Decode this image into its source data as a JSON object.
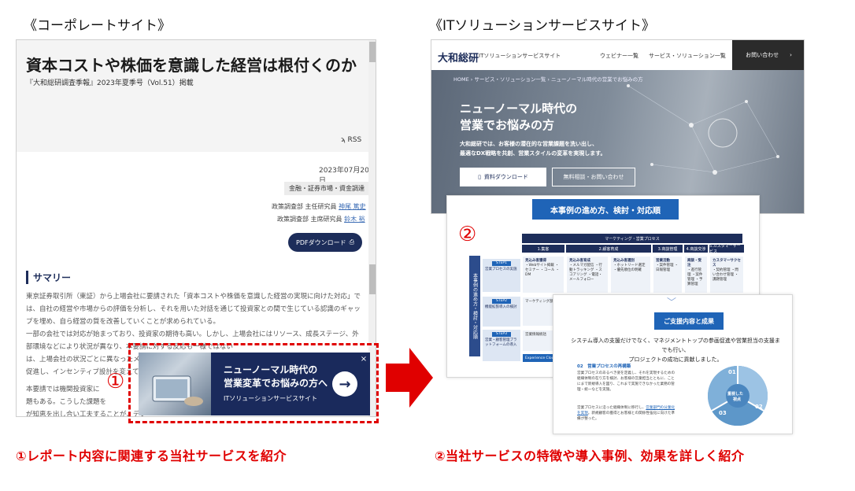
{
  "headings": {
    "left": "《コーポレートサイト》",
    "right": "《ITソリューションサービスサイト》"
  },
  "corporate": {
    "title": "資本コストや株価を意識した経営は根付くのか",
    "subtitle": "『大和総研調査季報』2023年夏季号（Vol.51）掲載",
    "rss": "RSS",
    "date": "2023年07月20日",
    "tag": "金融・証券市場・資金調達",
    "authors": [
      {
        "role": "政策調査部 主任研究員",
        "name": "神尾 篤史"
      },
      {
        "role": "政策調査部 主席研究員",
        "name": "鈴木 裕"
      }
    ],
    "pdf_button": "PDFダウンロード",
    "summary_heading": "サマリー",
    "paragraph1": "東京証券取引所（東証）から上場会社に要請された「資本コストや株価を意識した経営の実現に向けた対応」では、自社の経営や市場からの評価を分析し、それを用いた対話を通じて投資家との間で生じている認識のギャップを埋め、自ら経営の質を改善していくことが求められている。",
    "paragraph2": "一部の会社では対応が始まっており、投資家の期待も高い。しかし、上場会社にはリソース、成長ステージ、外部環境などにより状況が異なり、本要請に対する反応も一様ではない",
    "paragraph2b": "は、上場会社の状況ごとに異なったメッ",
    "paragraph2c": "促進し、インセンティブ設計を変えていく",
    "paragraph3a": "本要請では機関投資家に",
    "paragraph3b": "題もある。こうした課題を",
    "paragraph3c": "が知恵を出し合い工夫することが、デフ"
  },
  "banner": {
    "line1": "ニューノーマル時代の",
    "line2": "営業変革でお悩みの方へ",
    "sub": "ITソリューションサービスサイト",
    "close": "×",
    "arrow": "→"
  },
  "markers": {
    "one": "①",
    "two": "②"
  },
  "itsite": {
    "logo": "大和総研",
    "logo_sub": "ITソリューションサービスサイト",
    "nav": [
      "ウェビナー一覧",
      "サービス・ソリューション一覧"
    ],
    "contact": "お問い合わせ",
    "breadcrumb": "HOME › サービス・ソリューション一覧 › ニューノーマル時代の営業でお悩みの方",
    "hero_line1": "ニューノーマル時代の",
    "hero_line2": "営業でお悩みの方",
    "hero_desc1": "大和総研では、お客様の潜在的な営業課題を洗い出し、",
    "hero_desc2": "最適なDX戦略を共創、営業スタイルの変革を実現します。",
    "btn_download": "資料ダウンロード",
    "btn_consult": "無料相談・お問い合わせ"
  },
  "process": {
    "title": "本事例の進め方、検討・対応順",
    "header": "マーケティング・営業プロセス",
    "columns": [
      "1.集客",
      "2.顧客育成",
      "3.商談管理",
      "4.商談交渉",
      "5.カスタマーサービス"
    ],
    "side": "本事例の進め方・検討・対応順",
    "steps": [
      {
        "label": "STEP1",
        "text": "営業プロセスの実施"
      },
      {
        "label": "STEP2",
        "text": "機能拡張導入の検討"
      },
      {
        "label": "STEP3",
        "text": "営業・顧客管理プラットフォームの導入"
      }
    ],
    "cells": [
      {
        "title": "見込み客獲得",
        "text": "・Webサイト掲載 ・セミナー ・コール ・DM"
      },
      {
        "title": "見込み客育成",
        "text": "・メルマガ配信 ・行動トラッキング ・スコアリング ・電話・メールフォロー"
      },
      {
        "title": "見込み客選別",
        "text": "・ホットリード選定 ・優先順位の明確"
      },
      {
        "title": "営業活動",
        "text": "・案件管理 ・日報管理"
      },
      {
        "title": "商談・受注",
        "text": "・進行管理 ・案件管理 ・予算管理"
      },
      {
        "title": "カスタマーサクセス",
        "text": "・契約管理 ・問い合わせ管理 ・課題管理"
      }
    ],
    "row2": "マーケティング部門",
    "row3": "営業情報統括",
    "row4": "Experience Cloud"
  },
  "support": {
    "title": "ご支援内容と成果",
    "text1": "システム導入の支援だけでなく、マネジメントトップの参画促進や営業担当の支援までも行い、",
    "text2": "プロジェクトの成功に貢献しました。",
    "sub": "02　営業プロセスの再構築",
    "body1": "営業プロセスのあるべき姿を定義し、それを実現するための組織体制の在り方を検討、お客様の営業担当とともに、ことにまで新規導入を図り、これまで実施できなかった業務の管理・統一などを実施。",
    "body2": "営業プロセスに沿った組織体制に移行し、",
    "body2_link": "営業部門の分業化を実現",
    "body2_rest": "。新規顧客の獲得とお客様との関係性強化に向けた準備が整った。",
    "pie_center1": "重視した",
    "pie_center2": "視点",
    "pie_nums": [
      "01",
      "02",
      "03"
    ]
  },
  "captions": {
    "left": "①レポート内容に関連する当社サービスを紹介",
    "right": "②当社サービスの特徴や導入事例、効果を詳しく紹介"
  },
  "colors": {
    "accent_red": "#e00000",
    "navy": "#1d2d5a",
    "blue": "#1f64b7"
  }
}
